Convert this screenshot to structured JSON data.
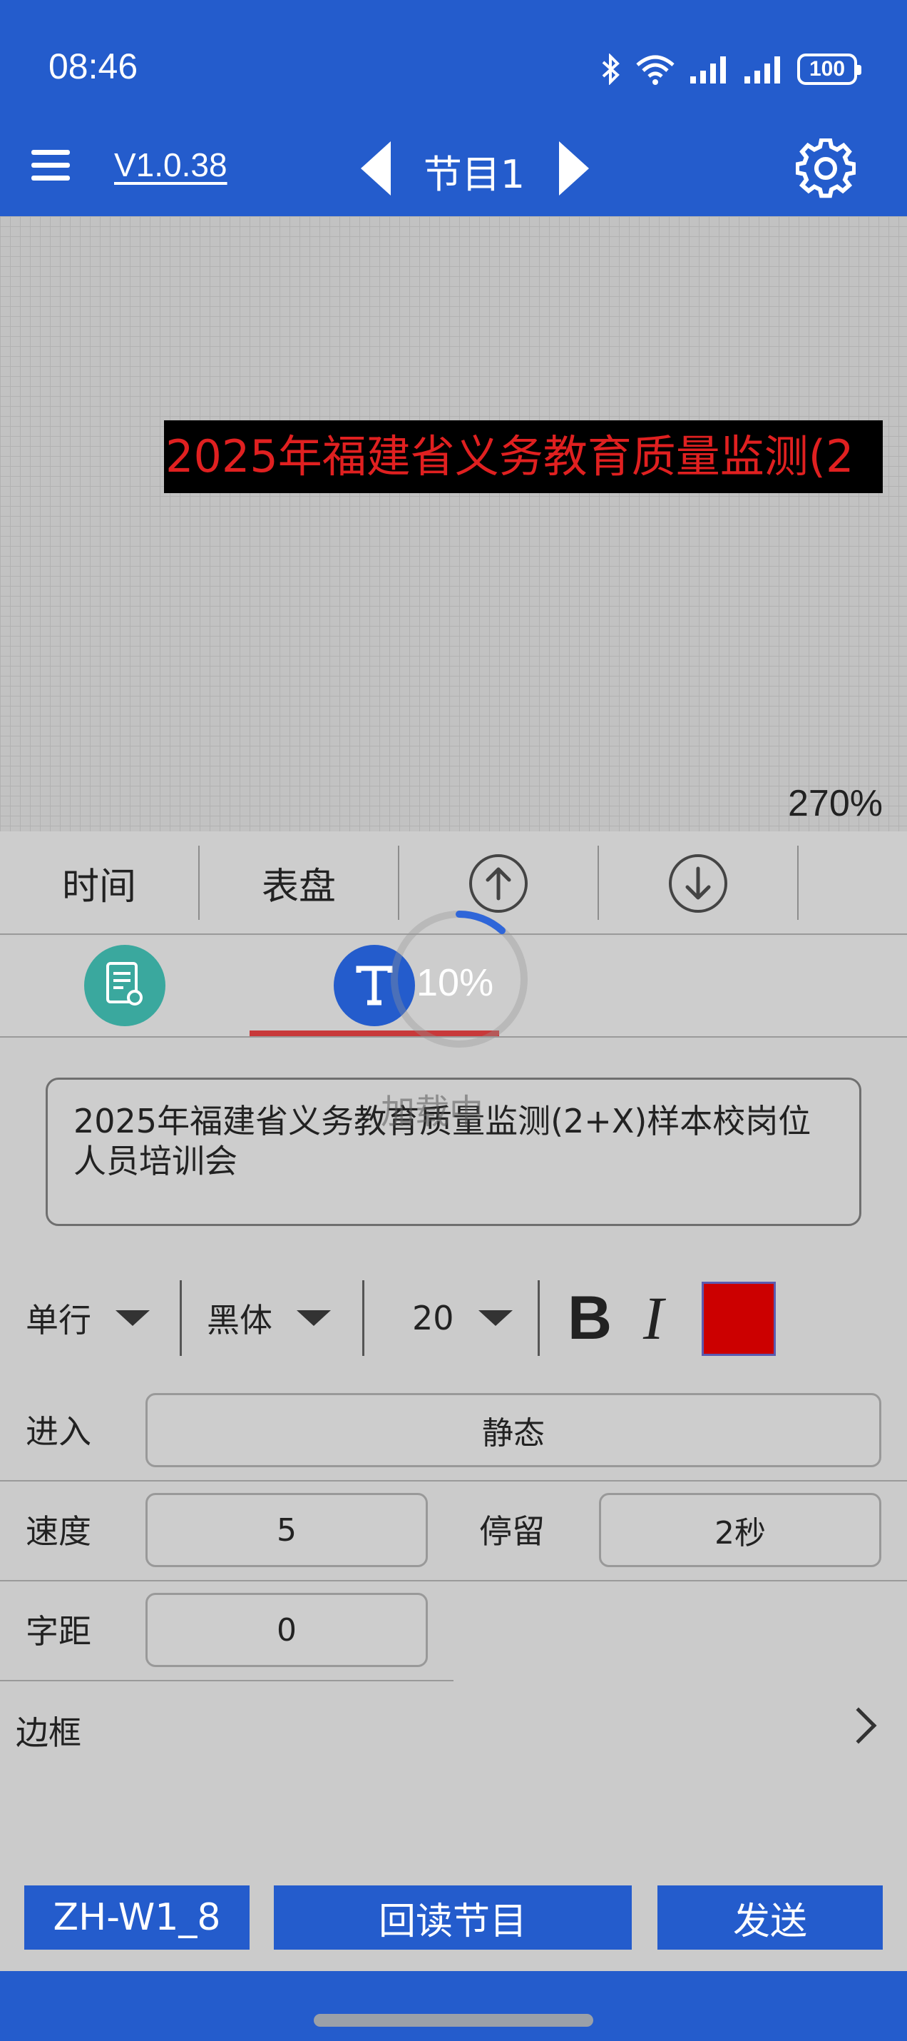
{
  "status_bar": {
    "time": "08:46",
    "battery": "100"
  },
  "header": {
    "version": "V1.0.38",
    "program_title": "节目1"
  },
  "canvas": {
    "led_text": "2025年福建省义务教育质量监测(2",
    "zoom": "270%",
    "led_text_color": "#e02020",
    "led_bg_color": "#000000"
  },
  "toolbar": {
    "time_label": "时间",
    "dial_label": "表盘"
  },
  "loading": {
    "percent": "10%",
    "label": "加载中"
  },
  "editor": {
    "text_value": "2025年福建省义务教育质量监测(2+X)样本校岗位人员培训会"
  },
  "format": {
    "line_mode": "单行",
    "font": "黑体",
    "font_size": "20",
    "bold_label": "B",
    "italic_label": "I",
    "color": "#cc0000"
  },
  "props": {
    "enter_label": "进入",
    "enter_value": "静态",
    "speed_label": "速度",
    "speed_value": "5",
    "stay_label": "停留",
    "stay_value": "2秒",
    "spacing_label": "字距",
    "spacing_value": "0"
  },
  "border": {
    "label": "边框"
  },
  "bottom": {
    "device_label": "ZH-W1_8",
    "readback_label": "回读节目",
    "send_label": "发送"
  },
  "colors": {
    "brand": "#245ccc",
    "underline": "#c8393a",
    "teal": "#3aa89e"
  }
}
